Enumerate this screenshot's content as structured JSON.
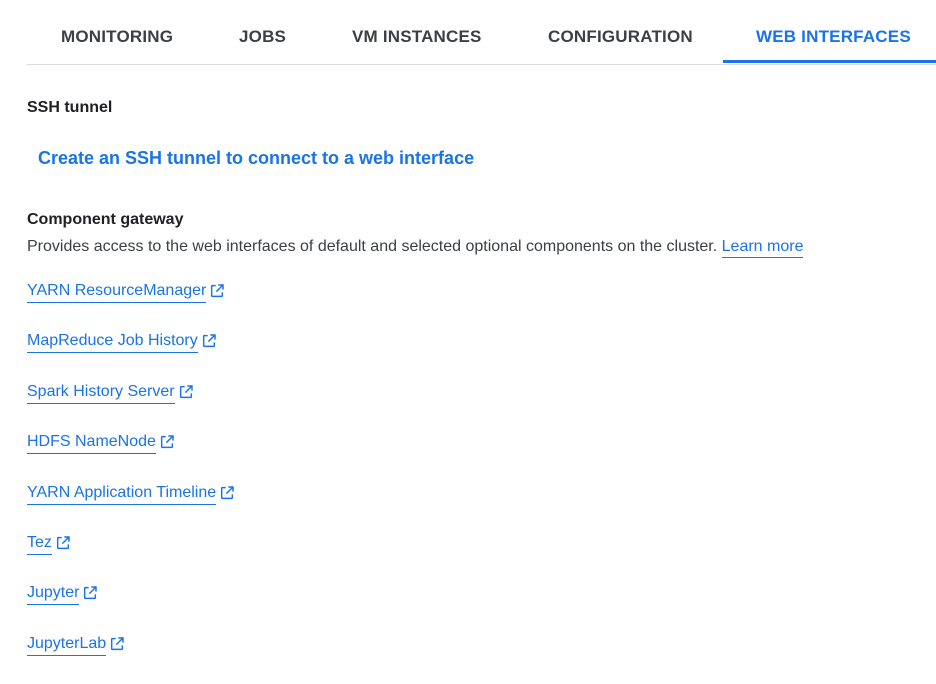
{
  "tabs": [
    {
      "label": "MONITORING",
      "active": false
    },
    {
      "label": "JOBS",
      "active": false
    },
    {
      "label": "VM INSTANCES",
      "active": false
    },
    {
      "label": "CONFIGURATION",
      "active": false
    },
    {
      "label": "WEB INTERFACES",
      "active": true
    }
  ],
  "ssh_tunnel": {
    "heading": "SSH tunnel",
    "link": "Create an SSH tunnel to connect to a web interface"
  },
  "component_gateway": {
    "heading": "Component gateway",
    "description": "Provides access to the web interfaces of default and selected optional components on the cluster. ",
    "learn_more": "Learn more",
    "links": [
      {
        "label": "YARN ResourceManager",
        "icon": "open-in-new-icon"
      },
      {
        "label": "MapReduce Job History",
        "icon": "open-in-new-icon"
      },
      {
        "label": "Spark History Server",
        "icon": "open-in-new-icon"
      },
      {
        "label": "HDFS NameNode",
        "icon": "open-in-new-icon"
      },
      {
        "label": "YARN Application Timeline",
        "icon": "open-in-new-icon"
      },
      {
        "label": "Tez",
        "icon": "open-in-new-icon"
      },
      {
        "label": "Jupyter",
        "icon": "open-in-new-icon"
      },
      {
        "label": "JupyterLab",
        "icon": "open-in-new-icon"
      }
    ]
  },
  "colors": {
    "accent": "#1a73e8",
    "text": "#3c4043",
    "divider": "#dadce0"
  }
}
